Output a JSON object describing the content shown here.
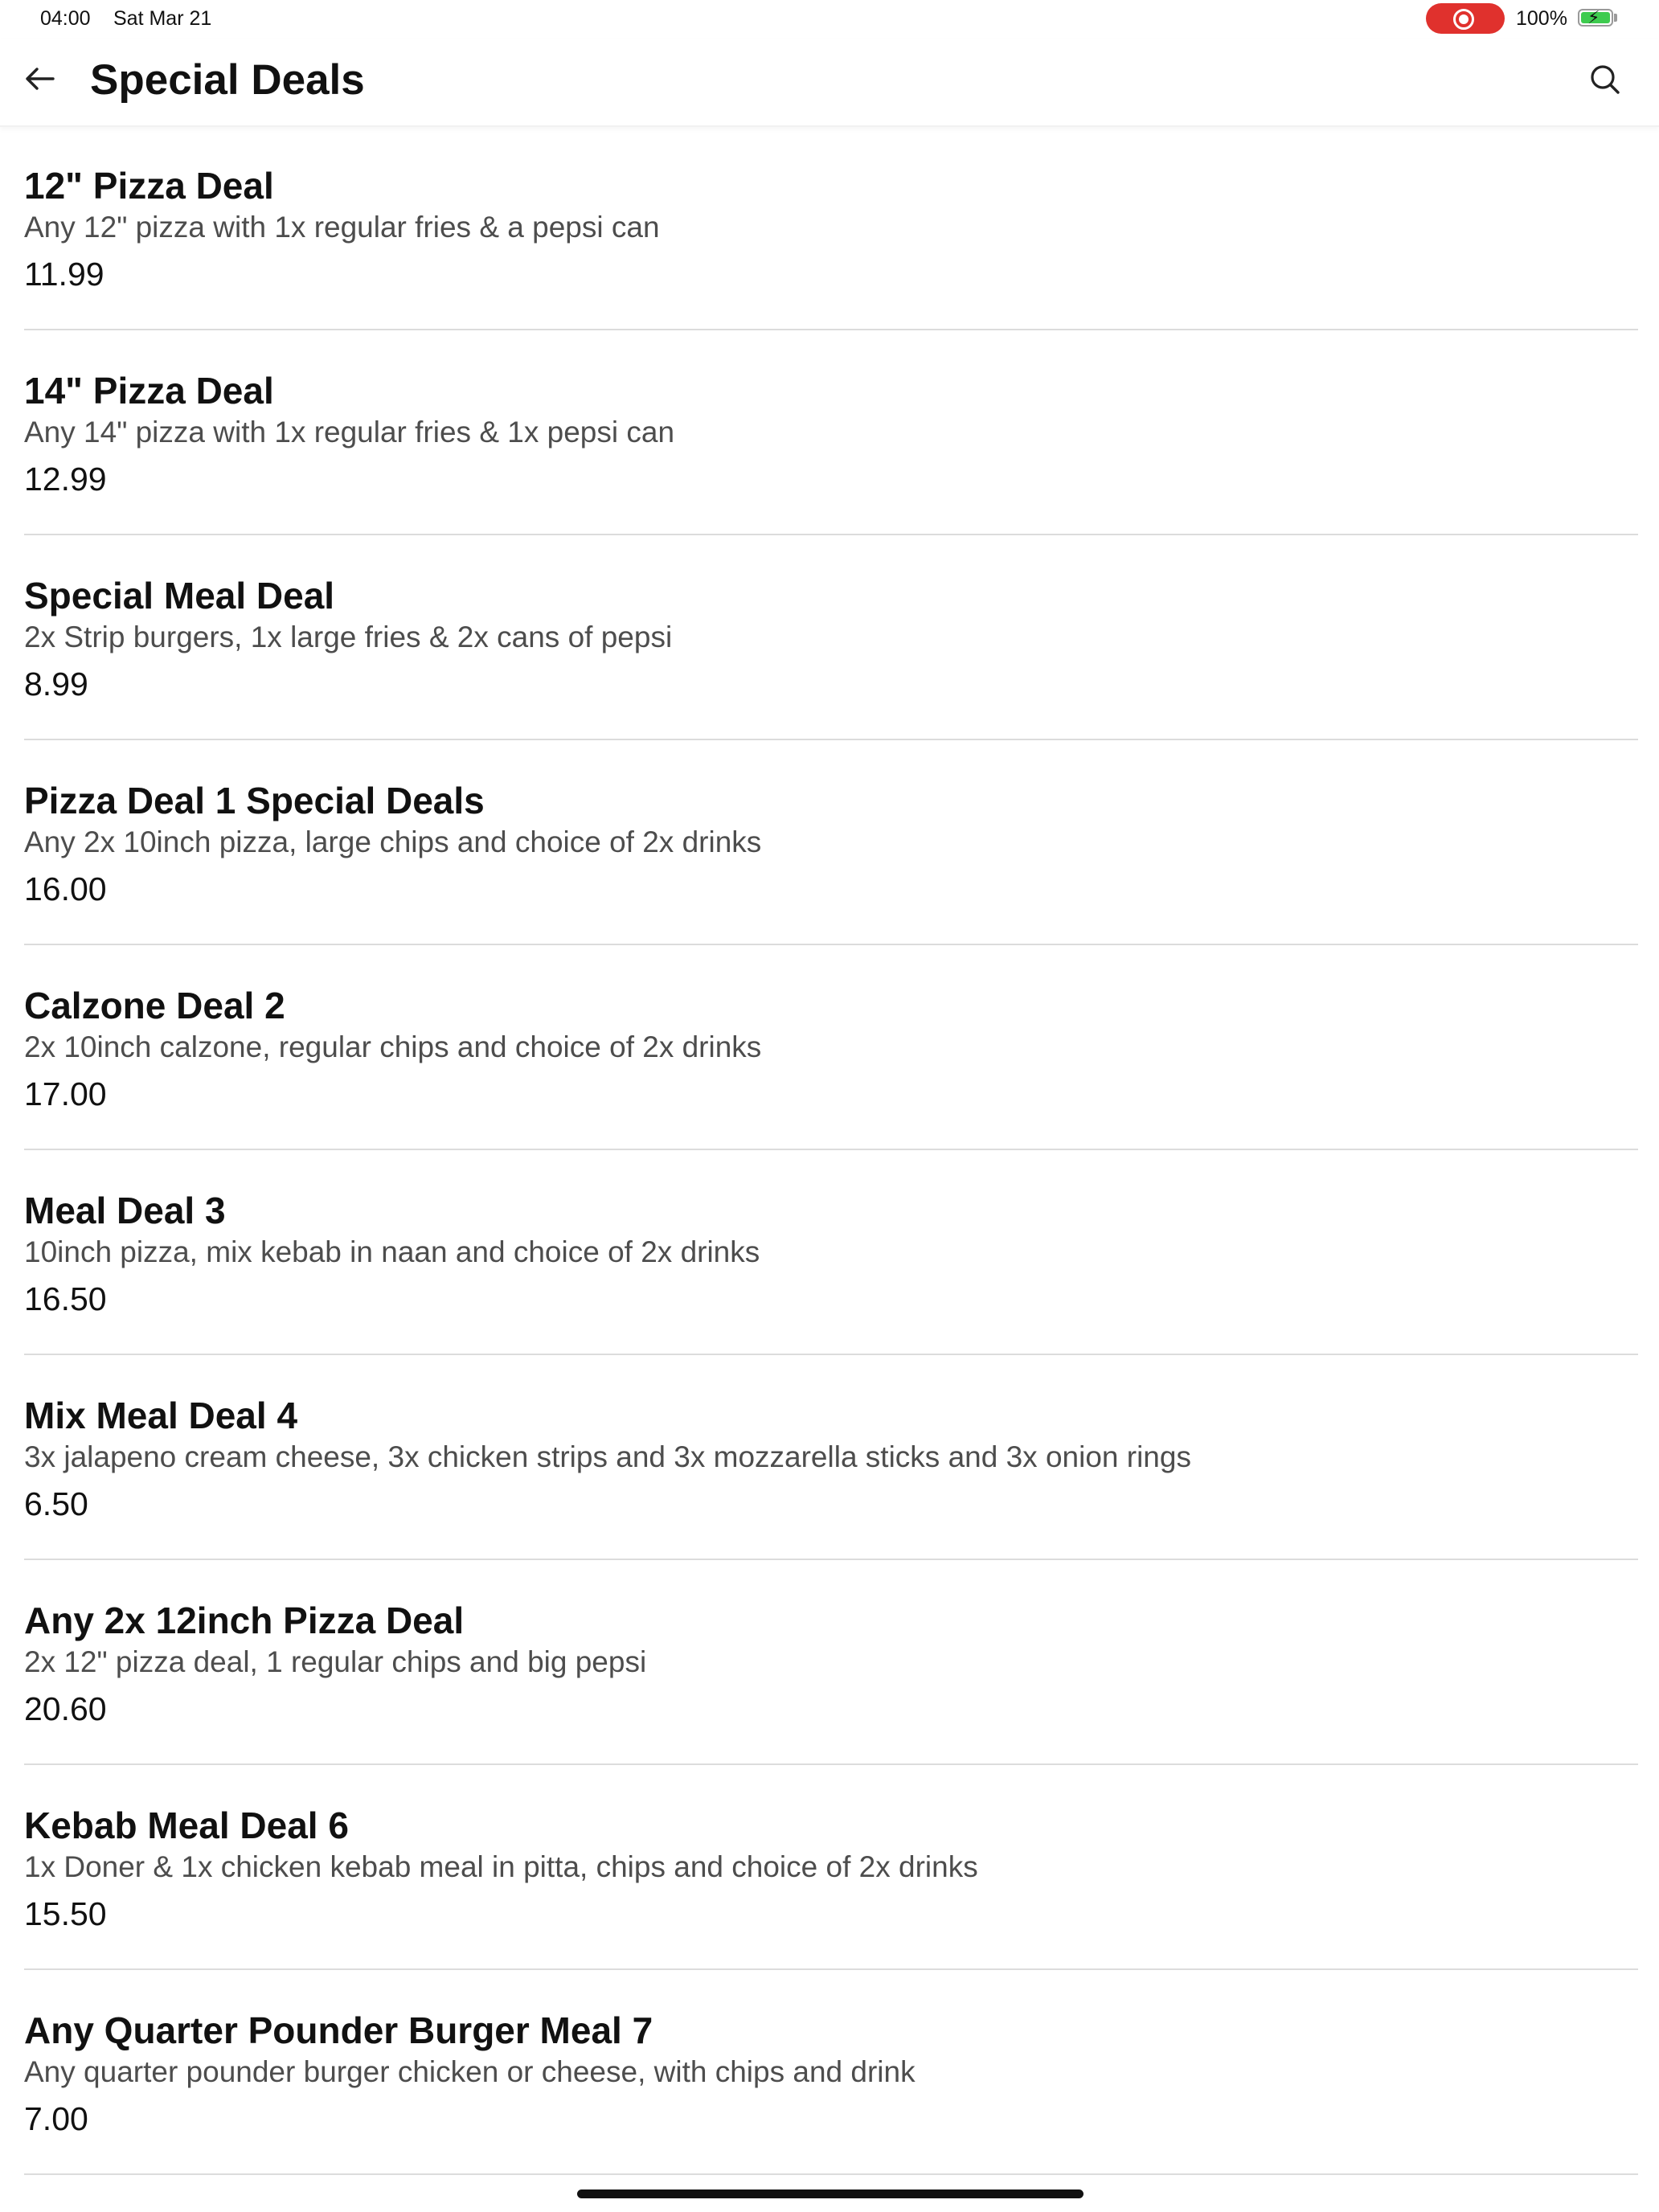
{
  "status_bar": {
    "time": "04:00",
    "date": "Sat Mar 21",
    "battery": "100%"
  },
  "header": {
    "title": "Special Deals",
    "back_icon": "arrow-left-icon",
    "search_icon": "search-icon"
  },
  "colors": {
    "record_indicator": "#e0312d",
    "battery_fill": "#3ecb4f"
  },
  "deals": [
    {
      "name": "12\" Pizza Deal",
      "description": "Any 12\" pizza with 1x regular fries & a pepsi can",
      "price": "11.99"
    },
    {
      "name": "14\" Pizza Deal",
      "description": "Any 14\" pizza with 1x regular fries & 1x pepsi can",
      "price": "12.99"
    },
    {
      "name": "Special Meal Deal",
      "description": "2x Strip burgers, 1x large fries & 2x cans of pepsi",
      "price": "8.99"
    },
    {
      "name": "Pizza Deal 1 Special Deals",
      "description": "Any 2x 10inch pizza, large chips and choice of 2x drinks",
      "price": "16.00"
    },
    {
      "name": "Calzone Deal 2",
      "description": "2x 10inch calzone, regular chips and choice of 2x drinks",
      "price": "17.00"
    },
    {
      "name": "Meal Deal 3",
      "description": "10inch pizza, mix kebab in naan and choice of 2x drinks",
      "price": "16.50"
    },
    {
      "name": "Mix Meal Deal 4",
      "description": "3x jalapeno cream cheese, 3x chicken strips and 3x mozzarella sticks and 3x onion rings",
      "price": "6.50"
    },
    {
      "name": "Any 2x 12inch Pizza Deal",
      "description": "2x 12\" pizza deal, 1 regular chips and big pepsi",
      "price": "20.60"
    },
    {
      "name": "Kebab Meal Deal 6",
      "description": "1x Doner & 1x chicken kebab meal in pitta, chips and choice of 2x drinks",
      "price": "15.50"
    },
    {
      "name": "Any Quarter Pounder Burger Meal 7",
      "description": "Any quarter pounder burger chicken or cheese, with chips and drink",
      "price": "7.00"
    }
  ]
}
